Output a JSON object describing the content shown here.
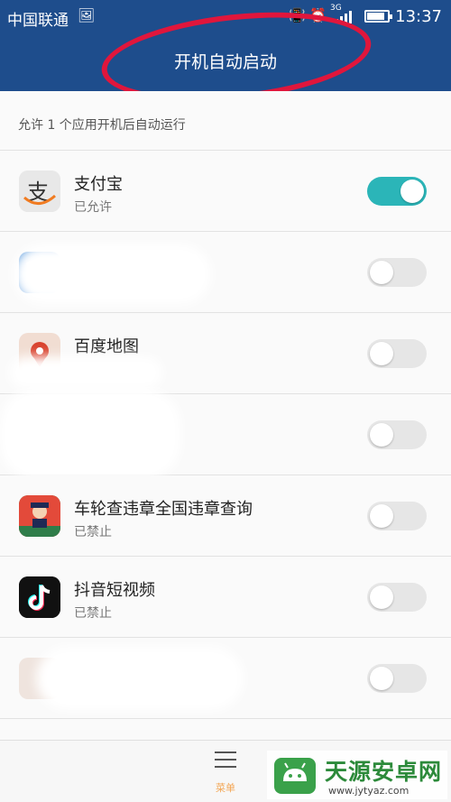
{
  "status_bar": {
    "carrier": "中国联通",
    "network": "3G",
    "time": "13:37",
    "battery_level": 0.85
  },
  "header": {
    "title": "开机自动启动"
  },
  "subtitle": "允许 1 个应用开机后自动运行",
  "apps": [
    {
      "name": "支付宝",
      "status": "已允许",
      "enabled": true
    },
    {
      "name": "",
      "status": "",
      "enabled": false
    },
    {
      "name": "百度地图",
      "status": "",
      "enabled": false
    },
    {
      "name": "",
      "status": "",
      "enabled": false
    },
    {
      "name": "车轮查违章全国违章查询",
      "status": "已禁止",
      "enabled": false
    },
    {
      "name": "抖音短视频",
      "status": "已禁止",
      "enabled": false
    },
    {
      "name": "",
      "status": "",
      "enabled": false
    }
  ],
  "bottom_bar": {
    "menu_label": "菜单"
  },
  "watermark": {
    "brand": "天源安卓网",
    "url": "www.jytyaz.com"
  },
  "colors": {
    "header_bg": "#1e4d8c",
    "toggle_on": "#2bb5b8",
    "annotation": "#e0163c",
    "watermark_green": "#2c8a3a"
  }
}
